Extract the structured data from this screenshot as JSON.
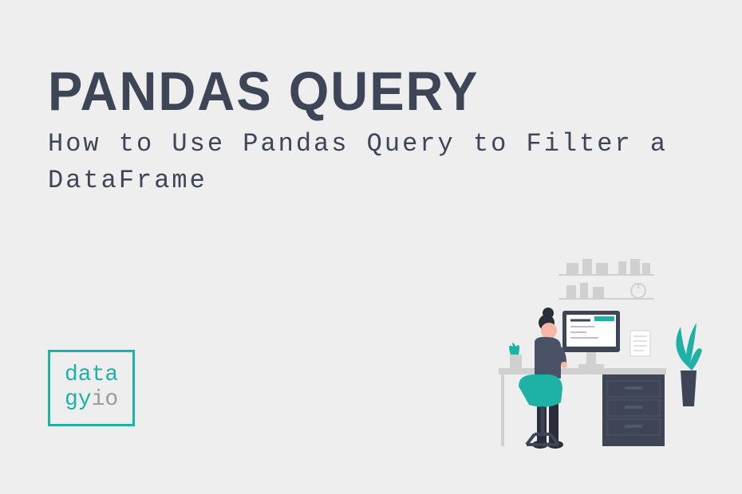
{
  "title": "Pandas Query",
  "subtitle": "How to Use Pandas Query to Filter a DataFrame",
  "logo": {
    "line1_part1": "data",
    "line2_part1": "gy",
    "line2_part2": "io"
  }
}
